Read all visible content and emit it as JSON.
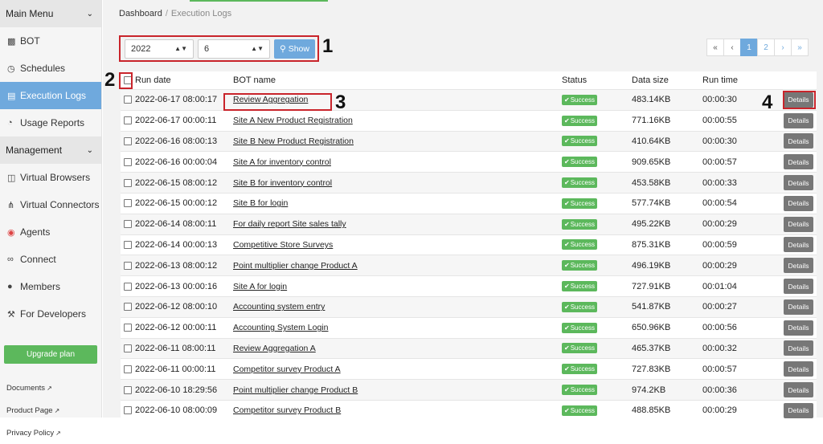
{
  "sidebar": {
    "main_menu": "Main Menu",
    "management": "Management",
    "main_items": [
      {
        "label": "BOT",
        "icon": "robot-icon"
      },
      {
        "label": "Schedules",
        "icon": "clock-icon"
      },
      {
        "label": "Execution Logs",
        "icon": "document-icon"
      },
      {
        "label": "Usage Reports",
        "icon": "pie-chart-icon"
      }
    ],
    "mgmt_items": [
      {
        "label": "Virtual Browsers",
        "icon": "browser-icon"
      },
      {
        "label": "Virtual Connectors",
        "icon": "connector-icon"
      },
      {
        "label": "Agents",
        "icon": "chrome-icon"
      },
      {
        "label": "Connect",
        "icon": "link-icon"
      },
      {
        "label": "Members",
        "icon": "users-icon"
      },
      {
        "label": "For Developers",
        "icon": "wrench-icon"
      }
    ],
    "upgrade": "Upgrade plan",
    "links": [
      "Documents",
      "Product Page",
      "Privacy Policy"
    ]
  },
  "breadcrumb": {
    "root": "Dashboard",
    "sep": "/",
    "current": "Execution Logs"
  },
  "filter": {
    "year": "2022",
    "month": "6",
    "show": "Show"
  },
  "annotations": [
    "1",
    "2",
    "3",
    "4"
  ],
  "pager": {
    "first": "«",
    "prev": "‹",
    "pages": [
      "1",
      "2"
    ],
    "next": "›",
    "last": "»"
  },
  "table": {
    "headers": {
      "date": "Run date",
      "bot": "BOT name",
      "status": "Status",
      "size": "Data size",
      "time": "Run time"
    },
    "details_label": "Details",
    "rows": [
      {
        "date": "2022-06-17 08:00:17",
        "bot": "Review Aggregation",
        "status": "Success",
        "size": "483.14KB",
        "time": "00:00:30"
      },
      {
        "date": "2022-06-17 00:00:11",
        "bot": "Site A New Product Registration",
        "status": "Success",
        "size": "771.16KB",
        "time": "00:00:55"
      },
      {
        "date": "2022-06-16 08:00:13",
        "bot": "Site B New Product Registration",
        "status": "Success",
        "size": "410.64KB",
        "time": "00:00:30"
      },
      {
        "date": "2022-06-16 00:00:04",
        "bot": "Site A for inventory control",
        "status": "Success",
        "size": "909.65KB",
        "time": "00:00:57"
      },
      {
        "date": "2022-06-15 08:00:12",
        "bot": "Site B for inventory control",
        "status": "Success",
        "size": "453.58KB",
        "time": "00:00:33"
      },
      {
        "date": "2022-06-15 00:00:12",
        "bot": "Site B for login",
        "status": "Success",
        "size": "577.74KB",
        "time": "00:00:54"
      },
      {
        "date": "2022-06-14 08:00:11",
        "bot": "For daily report Site sales tally",
        "status": "Success",
        "size": "495.22KB",
        "time": "00:00:29"
      },
      {
        "date": "2022-06-14 00:00:13",
        "bot": "Competitive Store Surveys",
        "status": "Success",
        "size": "875.31KB",
        "time": "00:00:59"
      },
      {
        "date": "2022-06-13 08:00:12",
        "bot": "Point multiplier change Product A",
        "status": "Success",
        "size": "496.19KB",
        "time": "00:00:29"
      },
      {
        "date": "2022-06-13 00:00:16",
        "bot": "Site A for login",
        "status": "Success",
        "size": "727.91KB",
        "time": "00:01:04"
      },
      {
        "date": "2022-06-12 08:00:10",
        "bot": "Accounting system entry",
        "status": "Success",
        "size": "541.87KB",
        "time": "00:00:27"
      },
      {
        "date": "2022-06-12 00:00:11",
        "bot": "Accounting System Login",
        "status": "Success",
        "size": "650.96KB",
        "time": "00:00:56"
      },
      {
        "date": "2022-06-11 08:00:11",
        "bot": "Review Aggregation A",
        "status": "Success",
        "size": "465.37KB",
        "time": "00:00:32"
      },
      {
        "date": "2022-06-11 00:00:11",
        "bot": "Competitor survey Product A",
        "status": "Success",
        "size": "727.83KB",
        "time": "00:00:57"
      },
      {
        "date": "2022-06-10 18:29:56",
        "bot": "Point multiplier change Product B",
        "status": "Success",
        "size": "974.2KB",
        "time": "00:00:36"
      },
      {
        "date": "2022-06-10 08:00:09",
        "bot": "Competitor survey Product B",
        "status": "Success",
        "size": "488.85KB",
        "time": "00:00:29"
      }
    ]
  }
}
